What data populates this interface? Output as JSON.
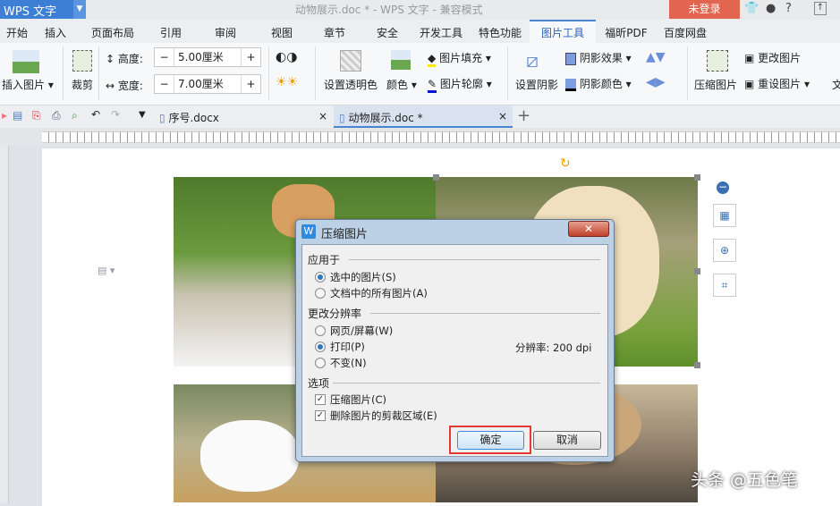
{
  "titlebar": {
    "app": "WPS 文字",
    "doc_title": "动物展示.doc * - WPS 文字 - 兼容模式",
    "login": "未登录",
    "help": "?"
  },
  "menu_tabs": [
    "开始",
    "插入",
    "页面布局",
    "引用",
    "审阅",
    "视图",
    "章节",
    "安全",
    "开发工具",
    "特色功能",
    "图片工具",
    "福昕PDF",
    "百度网盘"
  ],
  "active_tab": "图片工具",
  "ribbon": {
    "insert_picture": "插入图片",
    "crop": "裁剪",
    "height_label": "高度:",
    "height_value": "5.00厘米",
    "width_label": "宽度:",
    "width_value": "7.00厘米",
    "set_transparent": "设置透明色",
    "color": "颜色",
    "picture_fill": "图片填充",
    "picture_outline": "图片轮廓",
    "set_shadow": "设置阴影",
    "shadow_effect": "阴影效果",
    "shadow_color": "阴影颜色",
    "compress": "压缩图片",
    "change_picture": "更改图片",
    "reset_picture": "重设图片",
    "text_wrap": "文",
    "minus": "−",
    "plus": "+"
  },
  "doc_tabs": [
    {
      "label": "序号.docx",
      "active": false
    },
    {
      "label": "动物展示.doc *",
      "active": true
    }
  ],
  "dialog": {
    "title": "压缩图片",
    "apply_to": "应用于",
    "opt_selected": "选中的图片(S)",
    "opt_all": "文档中的所有图片(A)",
    "resolution_group": "更改分辨率",
    "opt_web": "网页/屏幕(W)",
    "opt_print": "打印(P)",
    "opt_none": "不变(N)",
    "resolution_text": "分辨率: 200 dpi",
    "options_group": "选项",
    "chk_compress": "压缩图片(C)",
    "chk_delete_crop": "删除图片的剪裁区域(E)",
    "ok": "确定",
    "cancel": "取消",
    "selected_apply": "selected",
    "selected_resolution": "print",
    "compress_checked": true,
    "delete_crop_checked": true
  },
  "watermark": "头条 @五色笔",
  "colors": {
    "accent": "#3d7fd4",
    "login": "#e2664f",
    "highlight": "#e53935"
  }
}
